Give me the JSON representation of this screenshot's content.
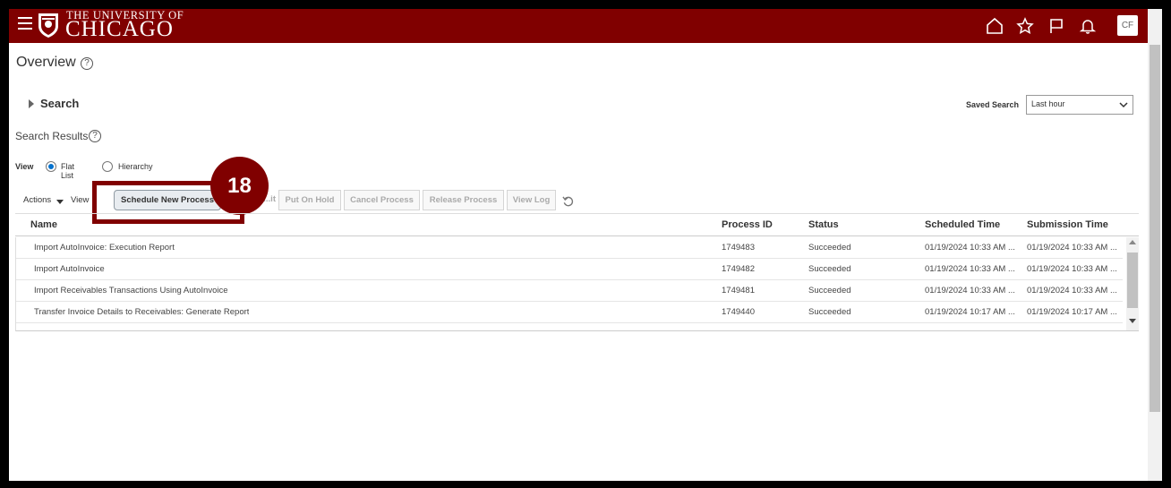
{
  "header": {
    "logo_top": "THE UNIVERSITY OF",
    "logo_main": "CHICAGO",
    "icons": [
      "home-icon",
      "star-icon",
      "flag-icon",
      "bell-icon"
    ],
    "avatar_initials": "CF",
    "brand_color": "#800000"
  },
  "page": {
    "title": "Overview",
    "help_glyph": "?"
  },
  "search": {
    "label": "Search",
    "saved_search_label": "Saved Search",
    "saved_search_value": "Last hour"
  },
  "results": {
    "title": "Search Results",
    "view_label": "View",
    "view_options": [
      "Flat List",
      "Hierarchy"
    ],
    "view_selected": "Flat List"
  },
  "toolbar": {
    "actions_label": "Actions",
    "view_label": "View",
    "schedule_label": "Schedule New Process",
    "resubmit_label": "...it",
    "put_on_hold_label": "Put On Hold",
    "cancel_label": "Cancel Process",
    "release_label": "Release Process",
    "view_log_label": "View Log"
  },
  "callout": {
    "step_number": "18"
  },
  "table": {
    "columns": [
      "Name",
      "Process ID",
      "Status",
      "Scheduled Time",
      "Submission Time"
    ],
    "rows": [
      {
        "name": "Import AutoInvoice: Execution Report",
        "process_id": "1749483",
        "status": "Succeeded",
        "scheduled": "01/19/2024 10:33 AM ...",
        "submitted": "01/19/2024 10:33 AM ..."
      },
      {
        "name": "Import AutoInvoice",
        "process_id": "1749482",
        "status": "Succeeded",
        "scheduled": "01/19/2024 10:33 AM ...",
        "submitted": "01/19/2024 10:33 AM ..."
      },
      {
        "name": "Import Receivables Transactions Using AutoInvoice",
        "process_id": "1749481",
        "status": "Succeeded",
        "scheduled": "01/19/2024 10:33 AM ...",
        "submitted": "01/19/2024 10:33 AM ..."
      },
      {
        "name": "Transfer Invoice Details to Receivables: Generate Report",
        "process_id": "1749440",
        "status": "Succeeded",
        "scheduled": "01/19/2024 10:17 AM ...",
        "submitted": "01/19/2024 10:17 AM ..."
      }
    ]
  }
}
